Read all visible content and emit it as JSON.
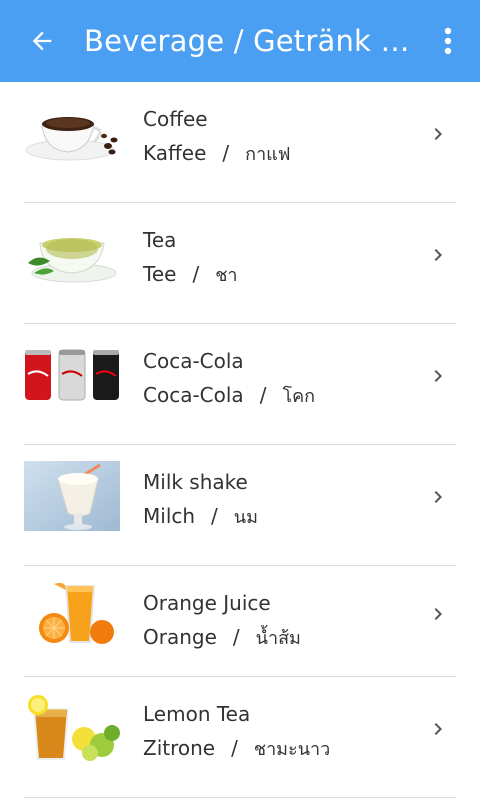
{
  "app_bar": {
    "title": "Beverage / Getränk / เ...",
    "back_icon": "arrow-left-icon",
    "menu_icon": "more-vert-icon",
    "color": "#4a9ff2"
  },
  "items": [
    {
      "name": "Coffee",
      "german": "Kaffee",
      "thai": "กาแฟ",
      "image": "coffee-cup-image"
    },
    {
      "name": "Tea",
      "german": "Tee",
      "thai": "ชา",
      "image": "tea-cup-image"
    },
    {
      "name": "Coca-Cola",
      "german": "Coca-Cola",
      "thai": "โคก",
      "image": "cola-cans-image"
    },
    {
      "name": "Milk shake",
      "german": "Milch",
      "thai": "นม",
      "image": "milkshake-image"
    },
    {
      "name": "Orange Juice",
      "german": "Orange",
      "thai": "น้ำส้ม",
      "image": "orange-juice-image"
    },
    {
      "name": "Lemon Tea",
      "german": "Zitrone",
      "thai": "ชามะนาว",
      "image": "lemon-tea-image"
    }
  ],
  "separator": "/"
}
